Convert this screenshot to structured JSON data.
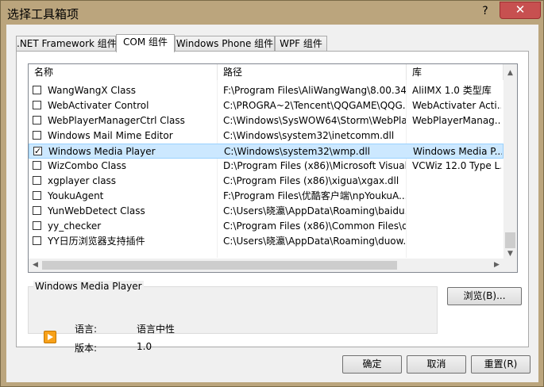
{
  "window": {
    "title": "选择工具箱项",
    "help": "?",
    "close": "✕"
  },
  "tabs": [
    {
      "label": ".NET Framework 组件"
    },
    {
      "label": "COM 组件"
    },
    {
      "label": "Windows Phone 组件"
    },
    {
      "label": "WPF 组件"
    }
  ],
  "list": {
    "columns": [
      "名称",
      "路径",
      "库"
    ],
    "rows": [
      {
        "checked": false,
        "name": "WangWangX Class",
        "path": "F:\\Program Files\\AliWangWang\\8.00.34...",
        "lib": "AliIMX 1.0 类型库"
      },
      {
        "checked": false,
        "name": "WebActivater Control",
        "path": "C:\\PROGRA~2\\Tencent\\QQGAME\\QQG...",
        "lib": "WebActivater Acti..."
      },
      {
        "checked": false,
        "name": "WebPlayerManagerCtrl Class",
        "path": "C:\\Windows\\SysWOW64\\Storm\\WebPla...",
        "lib": "WebPlayerManag..."
      },
      {
        "checked": false,
        "name": "Windows Mail Mime Editor",
        "path": "C:\\Windows\\system32\\inetcomm.dll",
        "lib": ""
      },
      {
        "checked": true,
        "name": "Windows Media Player",
        "path": "C:\\Windows\\system32\\wmp.dll",
        "lib": "Windows Media P..."
      },
      {
        "checked": false,
        "name": "WizCombo Class",
        "path": "D:\\Program Files (x86)\\Microsoft Visual S...",
        "lib": "VCWiz 12.0 Type L..."
      },
      {
        "checked": false,
        "name": "xgplayer class",
        "path": "C:\\Program Files (x86)\\xigua\\xgax.dll",
        "lib": ""
      },
      {
        "checked": false,
        "name": "YoukuAgent",
        "path": "F:\\Program Files\\优酷客户端\\npYoukuA...",
        "lib": ""
      },
      {
        "checked": false,
        "name": "YunWebDetect Class",
        "path": "C:\\Users\\晓瀛\\AppData\\Roaming\\baidu...",
        "lib": ""
      },
      {
        "checked": false,
        "name": "yy_checker",
        "path": "C:\\Program Files (x86)\\Common Files\\d...",
        "lib": ""
      },
      {
        "checked": false,
        "name": "YY日历浏览器支持插件",
        "path": "C:\\Users\\晓瀛\\AppData\\Roaming\\duow...",
        "lib": ""
      }
    ],
    "selected_index": 4,
    "scrollbar_arrows": {
      "up": "▲",
      "down": "▼",
      "left": "◀",
      "right": "▶"
    }
  },
  "details": {
    "group_title": "Windows Media Player",
    "language_label": "语言:",
    "language_value": "语言中性",
    "version_label": "版本:",
    "version_value": "1.0",
    "icon": "media-player-icon"
  },
  "buttons": {
    "browse": "浏览(B)...",
    "ok": "确定",
    "cancel": "取消",
    "reset": "重置(R)"
  },
  "colors": {
    "title_bar": "#bba57d",
    "close_button": "#c75050",
    "selection": "#cce8ff"
  }
}
